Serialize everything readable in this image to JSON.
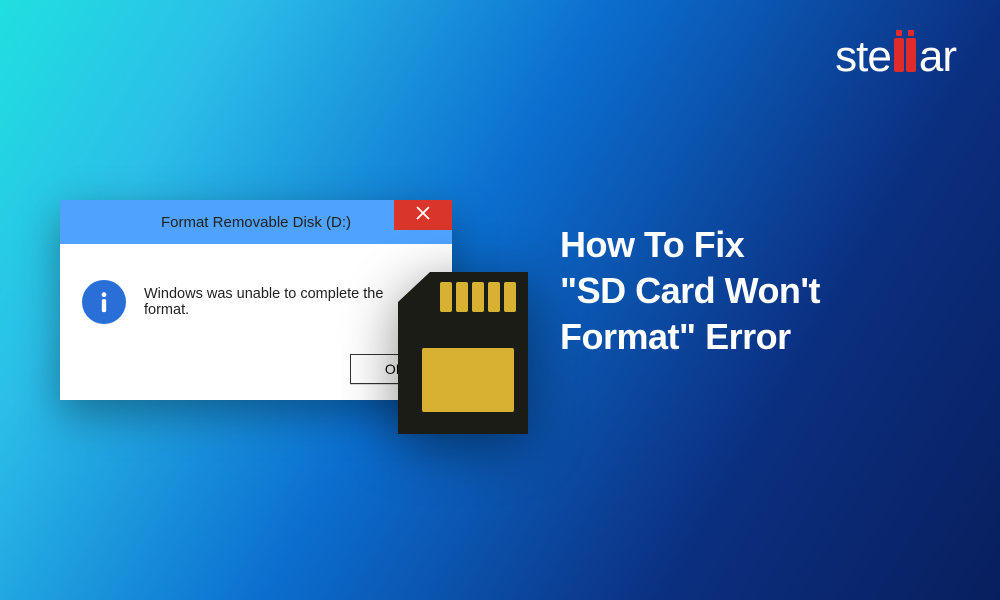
{
  "brand": {
    "part1": "ste",
    "part3": "ar"
  },
  "dialog": {
    "title": "Format Removable Disk (D:)",
    "message": "Windows was unable to complete the format.",
    "ok_label": "OK"
  },
  "headline": {
    "line1": "How To Fix",
    "line2a": "\"",
    "line2b": "SD Card Won't",
    "line3a": "Format",
    "line3b": "\" Error"
  }
}
